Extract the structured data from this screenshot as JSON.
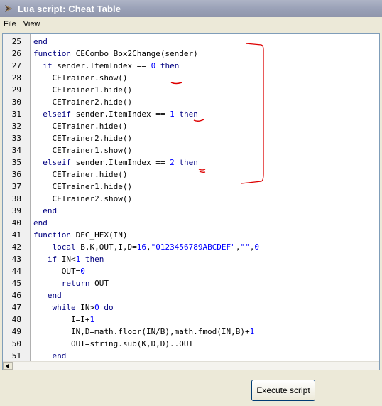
{
  "window": {
    "title": "Lua script: Cheat Table",
    "icon": "cheat-engine-icon"
  },
  "menu": [
    {
      "label": "File"
    },
    {
      "label": "View"
    }
  ],
  "code_lines": [
    {
      "n": "25",
      "text": "end"
    },
    {
      "n": "26",
      "text": "function CECombo Box2Change(sender)"
    },
    {
      "n": "27",
      "text": "  if sender.ItemIndex == 0 then"
    },
    {
      "n": "28",
      "text": "    CETrainer.show()"
    },
    {
      "n": "29",
      "text": "    CETrainer1.hide()"
    },
    {
      "n": "30",
      "text": "    CETrainer2.hide()"
    },
    {
      "n": "31",
      "text": "  elseif sender.ItemIndex == 1 then"
    },
    {
      "n": "32",
      "text": "    CETrainer.hide()"
    },
    {
      "n": "33",
      "text": "    CETrainer2.hide()"
    },
    {
      "n": "34",
      "text": "    CETrainer1.show()"
    },
    {
      "n": "35",
      "text": "  elseif sender.ItemIndex == 2 then"
    },
    {
      "n": "36",
      "text": "    CETrainer.hide()"
    },
    {
      "n": "37",
      "text": "    CETrainer1.hide()"
    },
    {
      "n": "38",
      "text": "    CETrainer2.show()"
    },
    {
      "n": "39",
      "text": "  end"
    },
    {
      "n": "40",
      "text": "end"
    },
    {
      "n": "41",
      "text": "function DEC_HEX(IN)"
    },
    {
      "n": "42",
      "text": "    local B,K,OUT,I,D=16,\"0123456789ABCDEF\",\"\",0"
    },
    {
      "n": "43",
      "text": "   if IN<1 then"
    },
    {
      "n": "44",
      "text": "      OUT=0"
    },
    {
      "n": "45",
      "text": "      return OUT"
    },
    {
      "n": "46",
      "text": "   end"
    },
    {
      "n": "47",
      "text": "    while IN>0 do"
    },
    {
      "n": "48",
      "text": "        I=I+1"
    },
    {
      "n": "49",
      "text": "        IN,D=math.floor(IN/B),math.fmod(IN,B)+1"
    },
    {
      "n": "50",
      "text": "        OUT=string.sub(K,D,D)..OUT"
    },
    {
      "n": "51",
      "text": "    end"
    }
  ],
  "execute_button": {
    "label": "Execute script"
  },
  "colors": {
    "keyword": "#000080",
    "number": "#0000ff",
    "annotation": "#dd0000"
  }
}
